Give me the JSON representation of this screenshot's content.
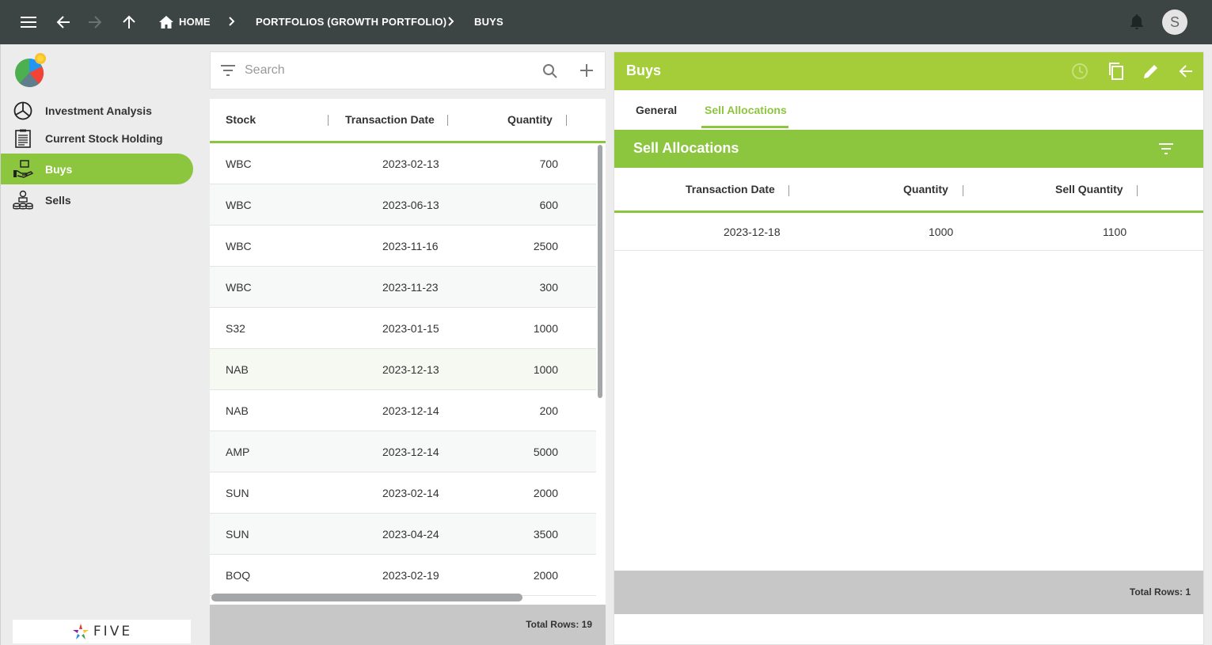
{
  "topbar": {
    "breadcrumbs": [
      "HOME",
      "PORTFOLIOS (GROWTH PORTFOLIO)",
      "BUYS"
    ],
    "avatar_initial": "S"
  },
  "sidebar": {
    "items": [
      {
        "label": "Investment Analysis",
        "icon": "pie-chart-icon"
      },
      {
        "label": "Current Stock Holding",
        "icon": "clipboard-list-icon"
      },
      {
        "label": "Buys",
        "icon": "hand-money-icon",
        "active": true
      },
      {
        "label": "Sells",
        "icon": "coin-stacks-icon"
      }
    ],
    "footer_logo": "FIVE"
  },
  "list": {
    "search_placeholder": "Search",
    "columns": [
      "Stock",
      "Transaction Date",
      "Quantity"
    ],
    "rows": [
      {
        "stock": "WBC",
        "date": "2023-02-13",
        "qty": "700"
      },
      {
        "stock": "WBC",
        "date": "2023-06-13",
        "qty": "600"
      },
      {
        "stock": "WBC",
        "date": "2023-11-16",
        "qty": "2500"
      },
      {
        "stock": "WBC",
        "date": "2023-11-23",
        "qty": "300"
      },
      {
        "stock": "S32",
        "date": "2023-01-15",
        "qty": "1000"
      },
      {
        "stock": "NAB",
        "date": "2023-12-13",
        "qty": "1000"
      },
      {
        "stock": "NAB",
        "date": "2023-12-14",
        "qty": "200"
      },
      {
        "stock": "AMP",
        "date": "2023-12-14",
        "qty": "5000"
      },
      {
        "stock": "SUN",
        "date": "2023-02-14",
        "qty": "2000"
      },
      {
        "stock": "SUN",
        "date": "2023-04-24",
        "qty": "3500"
      },
      {
        "stock": "BOQ",
        "date": "2023-02-19",
        "qty": "2000"
      }
    ],
    "total_rows": "Total Rows: 19"
  },
  "detail": {
    "title": "Buys",
    "tabs": [
      "General",
      "Sell Allocations"
    ],
    "active_tab": "Sell Allocations",
    "sub_title": "Sell Allocations",
    "columns": [
      "Transaction Date",
      "Quantity",
      "Sell Quantity"
    ],
    "rows": [
      {
        "date": "2023-12-18",
        "qty": "1000",
        "sell_qty": "1100"
      }
    ],
    "total_rows": "Total Rows: 1"
  },
  "colors": {
    "topbar": "#3c4543",
    "accent": "#8cc63f",
    "header_green": "#a4cd39"
  }
}
